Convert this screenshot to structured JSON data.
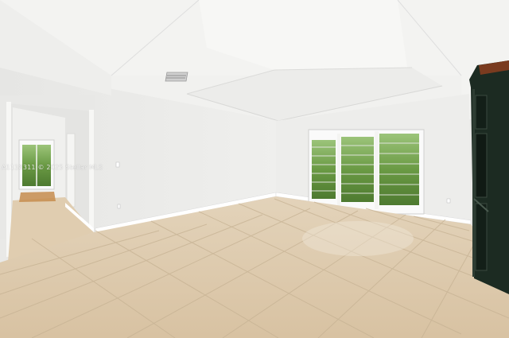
{
  "photo": {
    "watermark": "A1118311 © 2025 Stellar MLS",
    "colors": {
      "wall": "#ececea",
      "ceiling": "#f4f4f2",
      "tile": "#ddc9ac",
      "tile_grout": "#c9b697",
      "baseboard": "#ffffff",
      "cabinet": "#1c2b22",
      "cabinet_trim": "#7a3b1f",
      "foliage": "#5f8f3e"
    }
  }
}
